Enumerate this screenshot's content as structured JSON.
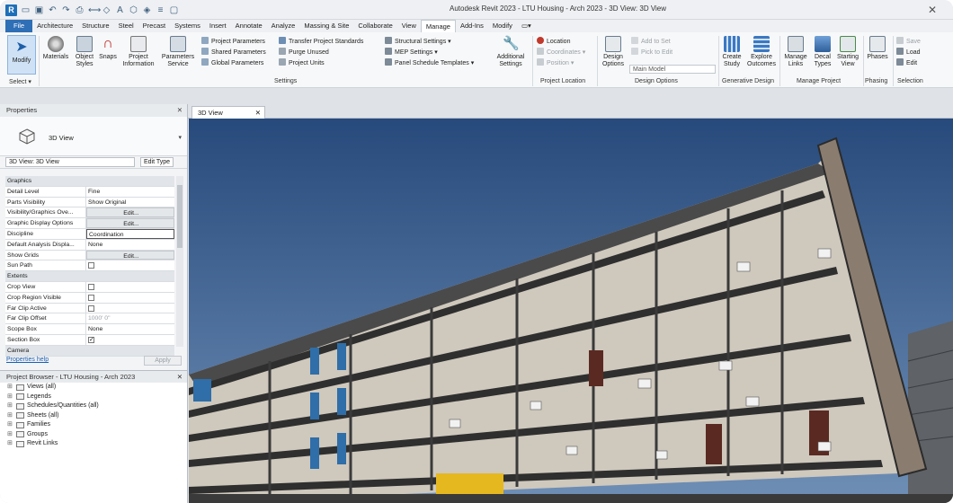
{
  "window": {
    "title": "Autodesk Revit 2023 - LTU Housing - Arch 2023 - 3D View: 3D View"
  },
  "tabs": [
    "File",
    "Architecture",
    "Structure",
    "Steel",
    "Precast",
    "Systems",
    "Insert",
    "Annotate",
    "Analyze",
    "Massing & Site",
    "Collaborate",
    "View",
    "Manage",
    "Add-Ins",
    "Modify"
  ],
  "active_tab": "Manage",
  "ribbon": {
    "modify": "Modify",
    "select_label": "Select ▾",
    "settings_big": [
      "Materials",
      "Object Styles",
      "Snaps",
      "Project Information",
      "Parameters Service"
    ],
    "settings_small": [
      "Project Parameters",
      "Shared Parameters",
      "Global Parameters",
      "Transfer Project Standards",
      "Purge Unused",
      "Project Units",
      "Structural Settings ▾",
      "MEP Settings ▾",
      "Panel Schedule Templates ▾"
    ],
    "additional_settings": "Additional Settings",
    "settings_label": "Settings",
    "location_items": [
      "Location",
      "Coordinates ▾",
      "Position ▾"
    ],
    "project_location_label": "Project Location",
    "design_options_btn": "Design Options",
    "design_small": [
      "Add to Set",
      "Pick to Edit"
    ],
    "main_model": "Main Model",
    "design_options_label": "Design Options",
    "generative": [
      "Create Study",
      "Explore Outcomes"
    ],
    "generative_label": "Generative Design",
    "manage_project": [
      "Manage Links",
      "Decal Types",
      "Starting View"
    ],
    "manage_project_label": "Manage Project",
    "phases": "Phases",
    "phasing_label": "Phasing",
    "selection_small": [
      "Save",
      "Load",
      "Edit"
    ],
    "selection_label": "Selection"
  },
  "properties": {
    "title": "Properties",
    "type_name": "3D View",
    "selector": "3D View: 3D View",
    "edit_type": "Edit Type",
    "rows": [
      {
        "cat": true,
        "k": "Graphics"
      },
      {
        "k": "Detail Level",
        "v": "Fine"
      },
      {
        "k": "Parts Visibility",
        "v": "Show Original"
      },
      {
        "k": "Visibility/Graphics Ove...",
        "v": "Edit...",
        "btn": true
      },
      {
        "k": "Graphic Display Options",
        "v": "Edit...",
        "btn": true
      },
      {
        "k": "Discipline",
        "v": "Coordination",
        "boxed": true
      },
      {
        "k": "Default Analysis Displa...",
        "v": "None"
      },
      {
        "k": "Show Grids",
        "v": "Edit...",
        "btn": true
      },
      {
        "k": "Sun Path",
        "v": "",
        "check": false
      },
      {
        "cat": true,
        "k": "Extents"
      },
      {
        "k": "Crop View",
        "v": "",
        "check": false
      },
      {
        "k": "Crop Region Visible",
        "v": "",
        "check": false
      },
      {
        "k": "Far Clip Active",
        "v": "",
        "check": false
      },
      {
        "k": "Far Clip Offset",
        "v": "1000' 0\"",
        "dim": true
      },
      {
        "k": "Scope Box",
        "v": "None"
      },
      {
        "k": "Section Box",
        "v": "",
        "check": true
      },
      {
        "cat": true,
        "k": "Camera"
      }
    ],
    "help": "Properties help",
    "apply": "Apply"
  },
  "browser": {
    "title": "Project Browser - LTU Housing - Arch 2023",
    "items": [
      "Views (all)",
      "Legends",
      "Schedules/Quantities (all)",
      "Sheets (all)",
      "Families",
      "Groups",
      "Revit Links"
    ]
  },
  "view_tab": "3D View",
  "colors": {
    "sky": "#2d4f82",
    "accent": "#2f6fb6",
    "facade": "#8a7d70"
  }
}
